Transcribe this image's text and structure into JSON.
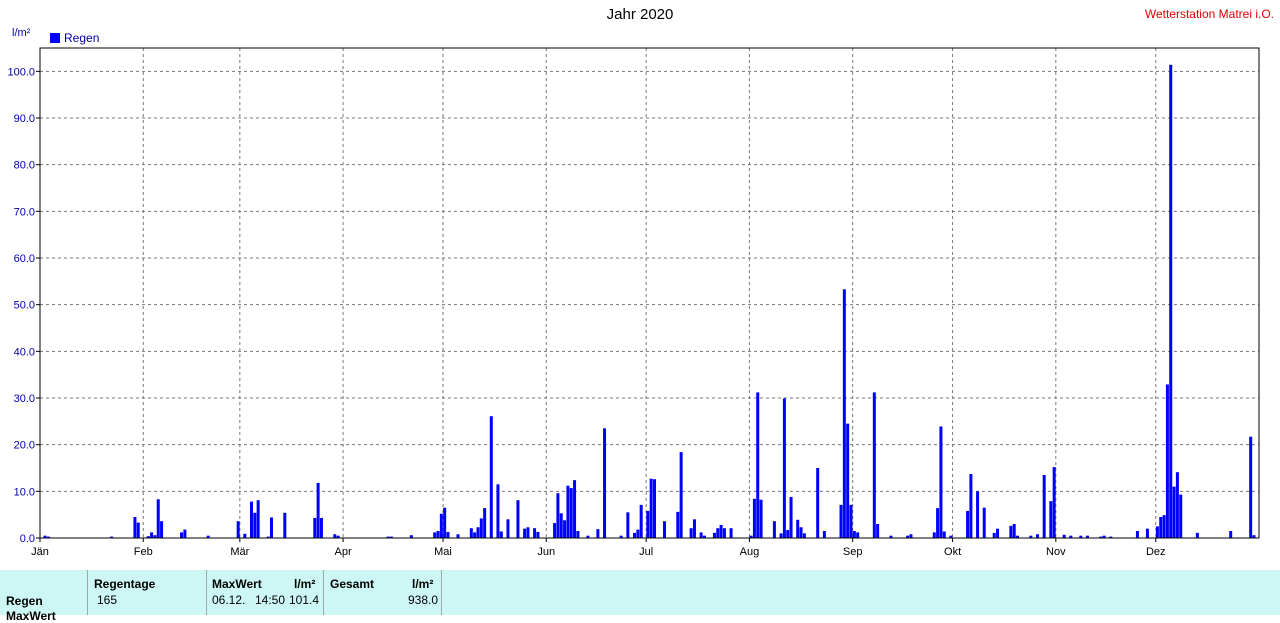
{
  "chart_data": {
    "type": "bar",
    "title": "Jahr 2020",
    "station": "Wetterstation Matrei i.O.",
    "ylabel": "l/m²",
    "legend": [
      {
        "name": "Regen",
        "color": "#0000ff"
      }
    ],
    "legend_position": "top-left",
    "grid": true,
    "ylim": [
      0,
      105
    ],
    "yticks": [
      "0.0",
      "10.0",
      "20.0",
      "30.0",
      "40.0",
      "50.0",
      "60.0",
      "70.0",
      "80.0",
      "90.0",
      "100.0"
    ],
    "months": [
      "Jän",
      "Feb",
      "Mär",
      "Apr",
      "Mai",
      "Jun",
      "Jul",
      "Aug",
      "Sep",
      "Okt",
      "Nov",
      "Dez"
    ],
    "x_unit": "day of year 2020",
    "series": [
      {
        "name": "Regen",
        "points": [
          [
            2,
            0.5
          ],
          [
            3,
            0.3
          ],
          [
            22,
            0.3
          ],
          [
            29,
            4.5
          ],
          [
            30,
            3.3
          ],
          [
            33,
            0.4
          ],
          [
            34,
            1.2
          ],
          [
            35,
            0.6
          ],
          [
            36,
            8.3
          ],
          [
            37,
            3.6
          ],
          [
            43,
            1.2
          ],
          [
            44,
            1.8
          ],
          [
            51,
            0.5
          ],
          [
            60,
            3.6
          ],
          [
            62,
            0.9
          ],
          [
            64,
            7.8
          ],
          [
            65,
            5.4
          ],
          [
            66,
            8.1
          ],
          [
            69,
            0.3
          ],
          [
            70,
            4.4
          ],
          [
            74,
            5.4
          ],
          [
            83,
            4.3
          ],
          [
            84,
            11.8
          ],
          [
            85,
            4.3
          ],
          [
            89,
            0.8
          ],
          [
            90,
            0.5
          ],
          [
            105,
            0.3
          ],
          [
            106,
            0.3
          ],
          [
            112,
            0.6
          ],
          [
            119,
            1.2
          ],
          [
            120,
            1.5
          ],
          [
            121,
            5.2
          ],
          [
            122,
            6.5
          ],
          [
            123,
            1.3
          ],
          [
            126,
            0.8
          ],
          [
            130,
            2.1
          ],
          [
            131,
            1.2
          ],
          [
            132,
            2.3
          ],
          [
            133,
            4.2
          ],
          [
            134,
            6.4
          ],
          [
            136,
            26.1
          ],
          [
            138,
            11.5
          ],
          [
            139,
            1.4
          ],
          [
            141,
            4.0
          ],
          [
            144,
            8.1
          ],
          [
            146,
            2.0
          ],
          [
            147,
            2.3
          ],
          [
            149,
            2.1
          ],
          [
            150,
            1.3
          ],
          [
            155,
            3.2
          ],
          [
            156,
            9.6
          ],
          [
            157,
            5.3
          ],
          [
            158,
            3.8
          ],
          [
            159,
            11.2
          ],
          [
            160,
            10.7
          ],
          [
            161,
            12.4
          ],
          [
            162,
            1.5
          ],
          [
            165,
            0.5
          ],
          [
            168,
            1.9
          ],
          [
            170,
            23.5
          ],
          [
            175,
            0.5
          ],
          [
            177,
            5.5
          ],
          [
            179,
            1.1
          ],
          [
            180,
            1.8
          ],
          [
            181,
            7.1
          ],
          [
            183,
            5.8
          ],
          [
            184,
            12.7
          ],
          [
            185,
            12.6
          ],
          [
            188,
            3.6
          ],
          [
            192,
            5.6
          ],
          [
            193,
            18.4
          ],
          [
            196,
            2.1
          ],
          [
            197,
            4.0
          ],
          [
            199,
            1.2
          ],
          [
            200,
            0.5
          ],
          [
            203,
            1.1
          ],
          [
            204,
            2.1
          ],
          [
            205,
            2.8
          ],
          [
            206,
            2.1
          ],
          [
            208,
            2.1
          ],
          [
            214,
            0.5
          ],
          [
            215,
            8.4
          ],
          [
            216,
            31.2
          ],
          [
            217,
            8.2
          ],
          [
            221,
            3.6
          ],
          [
            223,
            1.0
          ],
          [
            224,
            29.9
          ],
          [
            225,
            1.7
          ],
          [
            226,
            8.8
          ],
          [
            228,
            3.9
          ],
          [
            229,
            2.3
          ],
          [
            230,
            1.0
          ],
          [
            234,
            15.0
          ],
          [
            236,
            1.5
          ],
          [
            241,
            7.1
          ],
          [
            242,
            53.3
          ],
          [
            243,
            24.5
          ],
          [
            244,
            7.1
          ],
          [
            245,
            1.5
          ],
          [
            246,
            1.2
          ],
          [
            251,
            31.2
          ],
          [
            252,
            3.0
          ],
          [
            256,
            0.5
          ],
          [
            261,
            0.5
          ],
          [
            262,
            0.8
          ],
          [
            269,
            1.2
          ],
          [
            270,
            6.4
          ],
          [
            271,
            23.9
          ],
          [
            272,
            1.4
          ],
          [
            274,
            0.5
          ],
          [
            279,
            5.8
          ],
          [
            280,
            13.7
          ],
          [
            282,
            10.0
          ],
          [
            284,
            6.5
          ],
          [
            287,
            1.1
          ],
          [
            288,
            2.0
          ],
          [
            292,
            2.6
          ],
          [
            293,
            3.0
          ],
          [
            294,
            0.5
          ],
          [
            298,
            0.5
          ],
          [
            300,
            0.8
          ],
          [
            302,
            13.5
          ],
          [
            304,
            7.9
          ],
          [
            305,
            15.2
          ],
          [
            308,
            0.7
          ],
          [
            310,
            0.5
          ],
          [
            313,
            0.5
          ],
          [
            315,
            0.5
          ],
          [
            319,
            0.3
          ],
          [
            320,
            0.5
          ],
          [
            322,
            0.3
          ],
          [
            330,
            1.5
          ],
          [
            333,
            2.0
          ],
          [
            336,
            2.5
          ],
          [
            337,
            4.5
          ],
          [
            338,
            4.9
          ],
          [
            339,
            32.9
          ],
          [
            340,
            101.4
          ],
          [
            341,
            11.0
          ],
          [
            342,
            14.1
          ],
          [
            343,
            9.3
          ],
          [
            348,
            1.1
          ],
          [
            358,
            1.5
          ],
          [
            364,
            21.7
          ],
          [
            365,
            0.6
          ]
        ]
      }
    ]
  },
  "stats": {
    "regentage_label": "Regentage",
    "regentage_value": "165",
    "maxwert_label": "MaxWert",
    "unit1": "l/m²",
    "max_date": "06.12.",
    "max_time": "14:50",
    "max_value": "101.4",
    "gesamt_label": "Gesamt",
    "unit2": "l/m²",
    "gesamt_value": "938.0",
    "row1": "Regen",
    "row2": "MaxWert"
  }
}
